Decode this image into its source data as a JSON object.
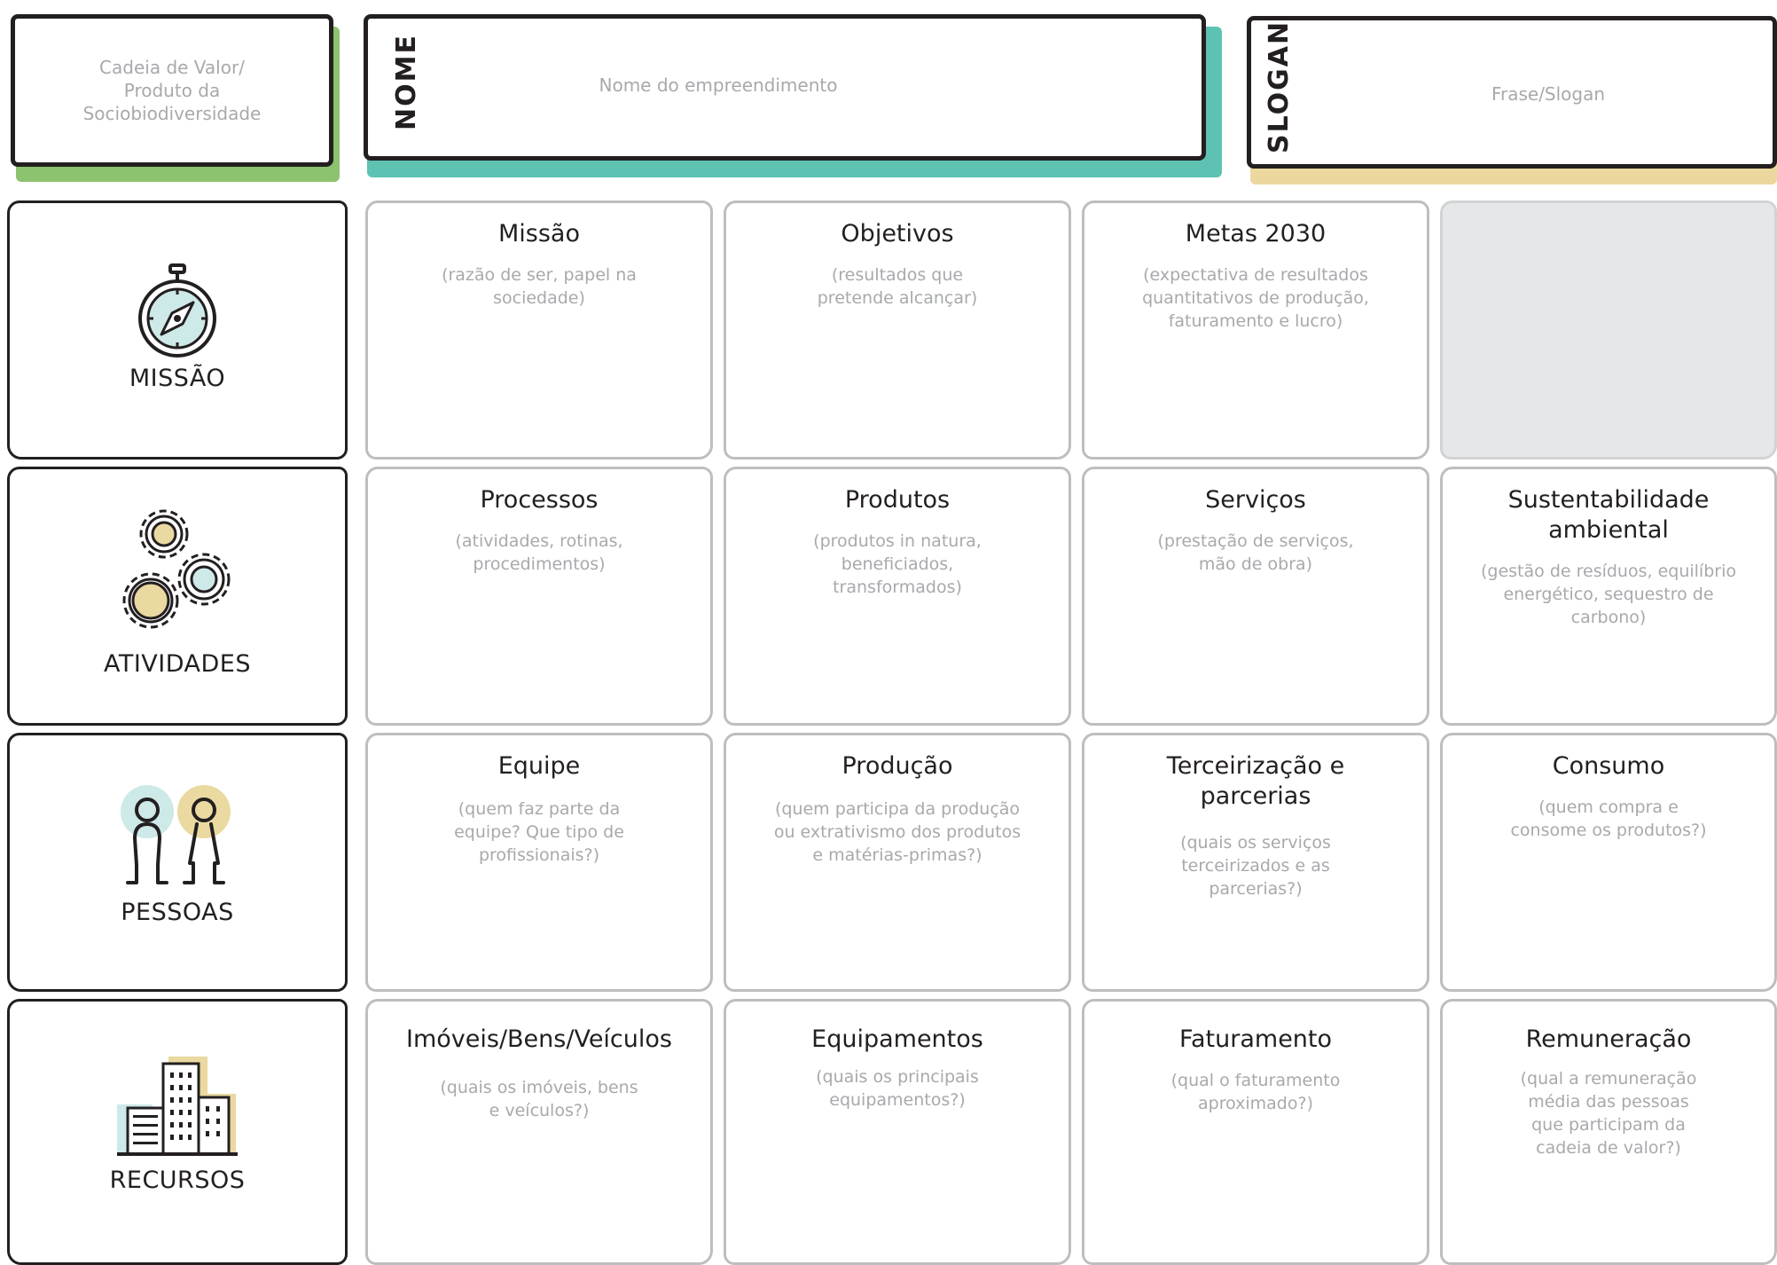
{
  "header": {
    "value_chain": "Cadeia de Valor/\nProduto da\nSociobiodiversidade",
    "name_label": "NOME",
    "name_placeholder": "Nome do empreendimento",
    "slogan_label": "SLOGAN",
    "slogan_placeholder": "Frase/Slogan"
  },
  "colors": {
    "green": "#8dc26f",
    "teal": "#5ec2b3",
    "sand": "#ecd89f",
    "icon_teal": "#cde9e8",
    "icon_sand": "#ead9a0",
    "empty_cell": "#e6e7e8"
  },
  "rows": [
    {
      "label": "MISSÃO",
      "icon": "compass-icon",
      "cells": [
        {
          "title": "Missão",
          "desc": "(razão de ser, papel na\nsociedade)"
        },
        {
          "title": "Objetivos",
          "desc": "(resultados que\npretende alcançar)"
        },
        {
          "title": "Metas 2030",
          "desc": "(expectativa de resultados\nquantitativos de produção,\nfaturamento e lucro)"
        },
        {
          "title": "",
          "desc": "",
          "filled": true
        }
      ]
    },
    {
      "label": "ATIVIDADES",
      "icon": "gears-icon",
      "cells": [
        {
          "title": "Processos",
          "desc": "(atividades, rotinas,\nprocedimentos)"
        },
        {
          "title": "Produtos",
          "desc": "(produtos in natura,\nbeneficiados,\ntransformados)"
        },
        {
          "title": "Serviços",
          "desc": "(prestação de serviços,\nmão de obra)"
        },
        {
          "title": "Sustentabilidade\nambiental",
          "desc": "(gestão de resíduos, equilíbrio\nenergético, sequestro de\ncarbono)"
        }
      ]
    },
    {
      "label": "PESSOAS",
      "icon": "people-icon",
      "cells": [
        {
          "title": "Equipe",
          "desc": "(quem faz parte da\nequipe? Que tipo de\nprofissionais?)"
        },
        {
          "title": "Produção",
          "desc": "(quem participa da produção\nou extrativismo dos produtos\ne matérias-primas?)"
        },
        {
          "title": "Terceirização e\nparcerias",
          "desc": "(quais os serviços\nterceirizados e as\nparcerias?)"
        },
        {
          "title": "Consumo",
          "desc": "(quem compra e\nconsome os produtos?)"
        }
      ]
    },
    {
      "label": "RECURSOS",
      "icon": "buildings-icon",
      "cells": [
        {
          "title": "Imóveis/Bens/Veículos",
          "desc": "(quais os imóveis, bens\ne veículos?)"
        },
        {
          "title": "Equipamentos",
          "desc": "(quais os principais\nequipamentos?)"
        },
        {
          "title": "Faturamento",
          "desc": "(qual o faturamento\naproximado?)"
        },
        {
          "title": "Remuneração",
          "desc": "(qual a remuneração\nmédia das pessoas\nque participam da\ncadeia de valor?)"
        }
      ]
    }
  ]
}
